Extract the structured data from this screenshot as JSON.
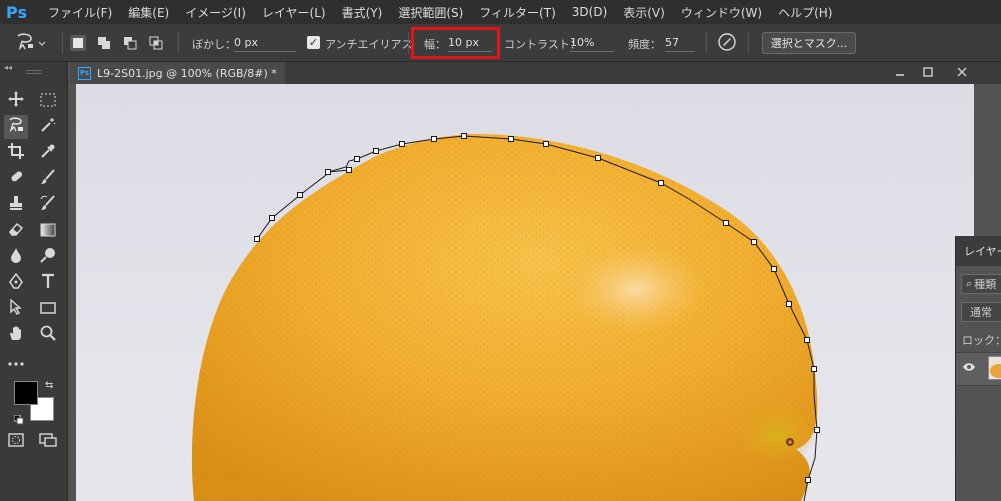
{
  "app": {
    "logo": "Ps"
  },
  "menubar": {
    "items": [
      "ファイル(F)",
      "編集(E)",
      "イメージ(I)",
      "レイヤー(L)",
      "書式(Y)",
      "選択範囲(S)",
      "フィルター(T)",
      "3D(D)",
      "表示(V)",
      "ウィンドウ(W)",
      "ヘルプ(H)"
    ]
  },
  "options": {
    "tool_icon": "magnetic-lasso-icon",
    "feather_label": "ぼかし：",
    "feather_value": "0 px",
    "antialias_label": "アンチエイリアス",
    "antialias_checked": true,
    "width_label": "幅：",
    "width_value": "10 px",
    "contrast_label": "コントラスト：",
    "contrast_value": "10%",
    "frequency_label": "頻度：",
    "frequency_value": "57",
    "select_mask_label": "選択とマスク..."
  },
  "document": {
    "tab_icon": "Ps",
    "tab_title": "L9-2S01.jpg @ 100% (RGB/8#) *"
  },
  "layers_panel": {
    "title": "レイヤー",
    "search_placeholder": "種類",
    "blend_mode": "通常",
    "lock_label": "ロック："
  },
  "colors": {
    "highlight": "#e11717",
    "foreground": "#000000",
    "background": "#ffffff",
    "ps_blue": "#31a8ff"
  }
}
